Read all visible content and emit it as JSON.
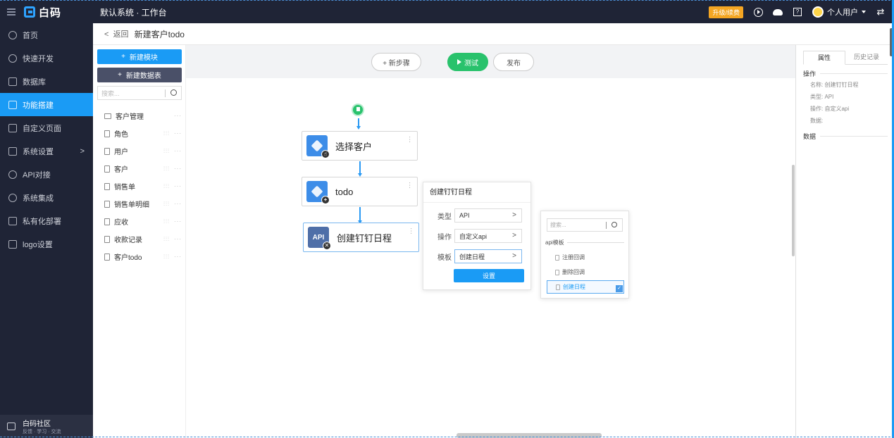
{
  "app": {
    "brand": "白码",
    "breadcrumb": "默认系统 · 工作台",
    "upgrade_badge": "升级/续费",
    "user_name": "个人用户",
    "accent_color": "#1a9bf5"
  },
  "sidebar": {
    "items": [
      {
        "label": "首页",
        "icon": "home-icon"
      },
      {
        "label": "快速开发",
        "icon": "cube-icon"
      },
      {
        "label": "数据库",
        "icon": "database-icon"
      },
      {
        "label": "功能搭建",
        "icon": "build-icon",
        "active": true
      },
      {
        "label": "自定义页面",
        "icon": "page-icon"
      },
      {
        "label": "系统设置",
        "icon": "monitor-icon",
        "chevron": ">"
      },
      {
        "label": "API对接",
        "icon": "gear-icon"
      },
      {
        "label": "系统集成",
        "icon": "integration-icon"
      },
      {
        "label": "私有化部署",
        "icon": "server-icon"
      },
      {
        "label": "logo设置",
        "icon": "logo-icon"
      }
    ],
    "community_title": "白码社区",
    "community_subtitle": "反馈 · 学习 · 交流"
  },
  "page": {
    "back_label": "返回",
    "back_chevron": "<",
    "title": "新建客户todo"
  },
  "module_panel": {
    "new_module": "新建模块",
    "new_table": "新建数据表",
    "search_placeholder": "搜索...",
    "items": [
      {
        "label": "客户管理",
        "type": "folder"
      },
      {
        "label": "角色",
        "type": "doc"
      },
      {
        "label": "用户",
        "type": "doc"
      },
      {
        "label": "客户",
        "type": "doc"
      },
      {
        "label": "销售单",
        "type": "doc"
      },
      {
        "label": "销售单明细",
        "type": "doc"
      },
      {
        "label": "应收",
        "type": "doc"
      },
      {
        "label": "收款记录",
        "type": "doc"
      },
      {
        "label": "客户todo",
        "type": "doc"
      }
    ],
    "more": "···",
    "settings_glyph": "⫶⫶⫶"
  },
  "toolbar": {
    "add_step": "+ 新步骤",
    "test": "测试",
    "publish": "发布"
  },
  "flow": {
    "nodes": [
      {
        "label": "选择客户",
        "badge": "☝"
      },
      {
        "label": "todo",
        "badge": "+"
      },
      {
        "label": "创建钉钉日程",
        "icon_text": "API",
        "badge": "✕"
      }
    ],
    "kebab": "···"
  },
  "popover": {
    "title": "创建钉钉日程",
    "rows": [
      {
        "label": "类型",
        "value": "API"
      },
      {
        "label": "操作",
        "value": "自定义api"
      },
      {
        "label": "模板",
        "value": "创建日程"
      }
    ],
    "chevron": ">",
    "button": "设置"
  },
  "template_panel": {
    "search_placeholder": "搜索...",
    "group": "api模板",
    "items": [
      {
        "label": "注册回调"
      },
      {
        "label": "删除回调"
      },
      {
        "label": "创建日程",
        "selected": true
      }
    ],
    "check": "✓"
  },
  "right_panel": {
    "tabs": [
      "属性",
      "历史记录"
    ],
    "section_operation": "操作",
    "props": [
      "名称: 创建钉钉日程",
      "类型: API",
      "操作: 自定义api",
      "数据:"
    ],
    "section_data": "数据"
  }
}
